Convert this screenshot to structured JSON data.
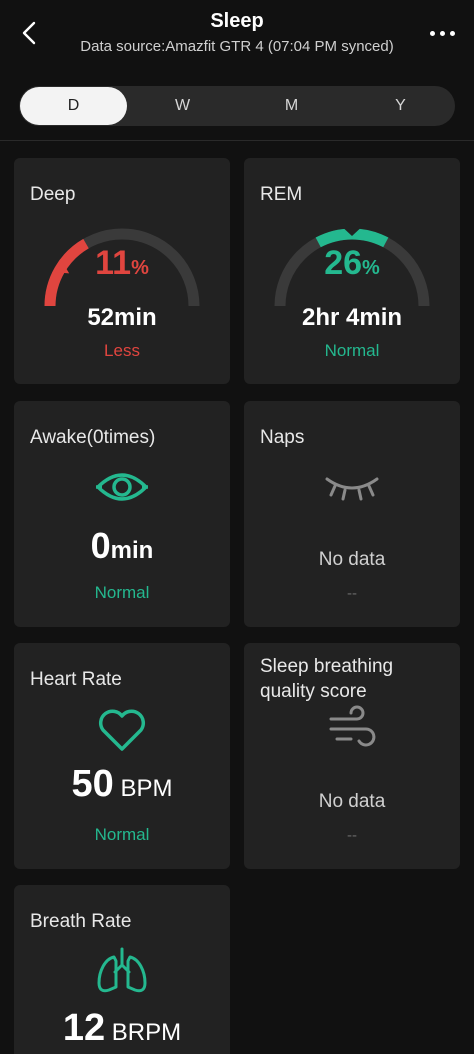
{
  "header": {
    "title": "Sleep",
    "subtitle": "Data source:Amazfit GTR 4 (07:04 PM synced)"
  },
  "tabs": [
    {
      "label": "D",
      "active": true
    },
    {
      "label": "W",
      "active": false
    },
    {
      "label": "M",
      "active": false
    },
    {
      "label": "Y",
      "active": false
    }
  ],
  "cards": {
    "deep": {
      "title": "Deep",
      "percent": "11",
      "percent_unit": "%",
      "duration": "52min",
      "status": "Less",
      "status_color": "#e0453f",
      "percent_value": 11
    },
    "rem": {
      "title": "REM",
      "percent": "26",
      "percent_unit": "%",
      "duration": "2hr 4min",
      "status": "Normal",
      "status_color": "#24b88f",
      "percent_value": 26
    },
    "awake": {
      "title": "Awake(0times)",
      "value": "0",
      "unit": "min",
      "status": "Normal",
      "icon": "eye-icon"
    },
    "naps": {
      "title": "Naps",
      "status": "No data",
      "sub": "--",
      "icon": "closed-eye-icon"
    },
    "heart_rate": {
      "title": "Heart Rate",
      "value": "50",
      "unit": "BPM",
      "status": "Normal",
      "icon": "heart-icon"
    },
    "breathing_quality": {
      "title_line1": "Sleep breathing",
      "title_line2": "quality score",
      "status": "No data",
      "sub": "--",
      "icon": "wind-icon"
    },
    "breath_rate": {
      "title": "Breath Rate",
      "value": "12",
      "unit": "BRPM",
      "icon": "lungs-icon"
    }
  },
  "colors": {
    "accent_green": "#24b88f",
    "alert_red": "#e0453f",
    "card_bg": "#222222",
    "background": "#111111"
  }
}
